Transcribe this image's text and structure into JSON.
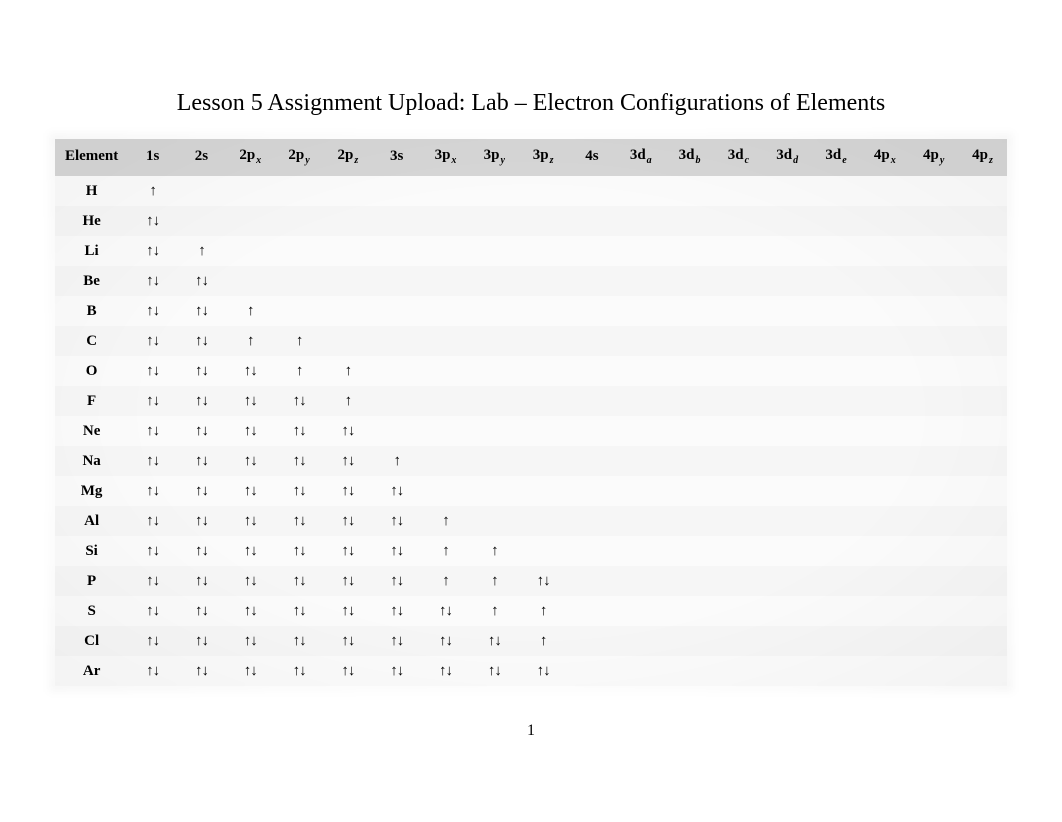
{
  "title": "Lesson 5 Assignment Upload: Lab – Electron Configurations of Elements",
  "page_number": "1",
  "headers": [
    {
      "label": "Element",
      "sub": ""
    },
    {
      "label": "1s",
      "sub": ""
    },
    {
      "label": "2s",
      "sub": ""
    },
    {
      "label": "2p",
      "sub": "x"
    },
    {
      "label": "2p",
      "sub": "y"
    },
    {
      "label": "2p",
      "sub": "z"
    },
    {
      "label": "3s",
      "sub": ""
    },
    {
      "label": "3p",
      "sub": "x"
    },
    {
      "label": "3p",
      "sub": "y"
    },
    {
      "label": "3p",
      "sub": "z"
    },
    {
      "label": "4s",
      "sub": ""
    },
    {
      "label": "3d",
      "sub": "a"
    },
    {
      "label": "3d",
      "sub": "b"
    },
    {
      "label": "3d",
      "sub": "c"
    },
    {
      "label": "3d",
      "sub": "d"
    },
    {
      "label": "3d",
      "sub": "e"
    },
    {
      "label": "4p",
      "sub": "x"
    },
    {
      "label": "4p",
      "sub": "y"
    },
    {
      "label": "4p",
      "sub": "z"
    }
  ],
  "rows": [
    {
      "el": "H",
      "cells": [
        "↑",
        "",
        "",
        "",
        "",
        "",
        "",
        "",
        "",
        "",
        "",
        "",
        "",
        "",
        "",
        "",
        "",
        ""
      ]
    },
    {
      "el": "He",
      "cells": [
        "↑↓",
        "",
        "",
        "",
        "",
        "",
        "",
        "",
        "",
        "",
        "",
        "",
        "",
        "",
        "",
        "",
        "",
        ""
      ]
    },
    {
      "el": "Li",
      "cells": [
        "↑↓",
        "↑",
        "",
        "",
        "",
        "",
        "",
        "",
        "",
        "",
        "",
        "",
        "",
        "",
        "",
        "",
        "",
        ""
      ]
    },
    {
      "el": "Be",
      "cells": [
        "↑↓",
        "↑↓",
        "",
        "",
        "",
        "",
        "",
        "",
        "",
        "",
        "",
        "",
        "",
        "",
        "",
        "",
        "",
        ""
      ]
    },
    {
      "el": "B",
      "cells": [
        "↑↓",
        "↑↓",
        "↑",
        "",
        "",
        "",
        "",
        "",
        "",
        "",
        "",
        "",
        "",
        "",
        "",
        "",
        "",
        ""
      ]
    },
    {
      "el": "C",
      "cells": [
        "↑↓",
        "↑↓",
        "↑",
        "↑",
        "",
        "",
        "",
        "",
        "",
        "",
        "",
        "",
        "",
        "",
        "",
        "",
        "",
        ""
      ]
    },
    {
      "el": "O",
      "cells": [
        "↑↓",
        "↑↓",
        "↑↓",
        "↑",
        "↑",
        "",
        "",
        "",
        "",
        "",
        "",
        "",
        "",
        "",
        "",
        "",
        "",
        ""
      ]
    },
    {
      "el": "F",
      "cells": [
        "↑↓",
        "↑↓",
        "↑↓",
        "↑↓",
        "↑",
        "",
        "",
        "",
        "",
        "",
        "",
        "",
        "",
        "",
        "",
        "",
        "",
        ""
      ]
    },
    {
      "el": "Ne",
      "cells": [
        "↑↓",
        "↑↓",
        "↑↓",
        "↑↓",
        "↑↓",
        "",
        "",
        "",
        "",
        "",
        "",
        "",
        "",
        "",
        "",
        "",
        "",
        ""
      ]
    },
    {
      "el": "Na",
      "cells": [
        "↑↓",
        "↑↓",
        "↑↓",
        "↑↓",
        "↑↓",
        "↑",
        "",
        "",
        "",
        "",
        "",
        "",
        "",
        "",
        "",
        "",
        "",
        ""
      ]
    },
    {
      "el": "Mg",
      "cells": [
        "↑↓",
        "↑↓",
        "↑↓",
        "↑↓",
        "↑↓",
        "↑↓",
        "",
        "",
        "",
        "",
        "",
        "",
        "",
        "",
        "",
        "",
        "",
        ""
      ]
    },
    {
      "el": "Al",
      "cells": [
        "↑↓",
        "↑↓",
        "↑↓",
        "↑↓",
        "↑↓",
        "↑↓",
        "↑",
        "",
        "",
        "",
        "",
        "",
        "",
        "",
        "",
        "",
        "",
        ""
      ]
    },
    {
      "el": "Si",
      "cells": [
        "↑↓",
        "↑↓",
        "↑↓",
        "↑↓",
        "↑↓",
        "↑↓",
        "↑",
        "↑",
        "",
        "",
        "",
        "",
        "",
        "",
        "",
        "",
        "",
        ""
      ]
    },
    {
      "el": "P",
      "cells": [
        "↑↓",
        "↑↓",
        "↑↓",
        "↑↓",
        "↑↓",
        "↑↓",
        "↑",
        "↑",
        "↑↓",
        "",
        "",
        "",
        "",
        "",
        "",
        "",
        "",
        ""
      ]
    },
    {
      "el": "S",
      "cells": [
        "↑↓",
        "↑↓",
        "↑↓",
        "↑↓",
        "↑↓",
        "↑↓",
        "↑↓",
        "↑",
        "↑",
        "",
        "",
        "",
        "",
        "",
        "",
        "",
        "",
        ""
      ]
    },
    {
      "el": "Cl",
      "cells": [
        "↑↓",
        "↑↓",
        "↑↓",
        "↑↓",
        "↑↓",
        "↑↓",
        "↑↓",
        "↑↓",
        "↑",
        "",
        "",
        "",
        "",
        "",
        "",
        "",
        "",
        ""
      ]
    },
    {
      "el": "Ar",
      "cells": [
        "↑↓",
        "↑↓",
        "↑↓",
        "↑↓",
        "↑↓",
        "↑↓",
        "↑↓",
        "↑↓",
        "↑↓",
        "",
        "",
        "",
        "",
        "",
        "",
        "",
        "",
        ""
      ]
    }
  ]
}
